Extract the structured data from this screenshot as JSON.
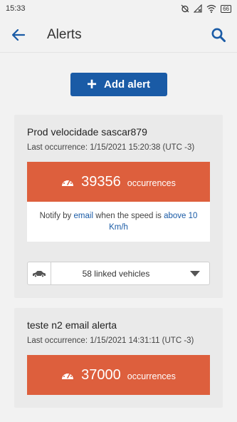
{
  "status": {
    "time": "15:33",
    "battery": "66"
  },
  "appbar": {
    "title": "Alerts"
  },
  "add_button": {
    "label": "Add alert"
  },
  "alerts": [
    {
      "title": "Prod velocidade sascar879",
      "last_occurrence": "Last occurrence: 1/15/2021 15:20:38 (UTC -3)",
      "count": "39356",
      "count_label": "occurrences",
      "notify_prefix": "Notify by",
      "notify_channel": "email",
      "notify_middle": "when the speed is",
      "notify_condition": "above 10 Km/h",
      "linked": "58 linked vehicles"
    },
    {
      "title": "teste n2 email alerta",
      "last_occurrence": "Last occurrence: 1/15/2021 14:31:11 (UTC -3)",
      "count": "37000",
      "count_label": "occurrences"
    }
  ],
  "colors": {
    "primary": "#1a5ba6",
    "occurrence_bg": "#dd5f3d"
  }
}
